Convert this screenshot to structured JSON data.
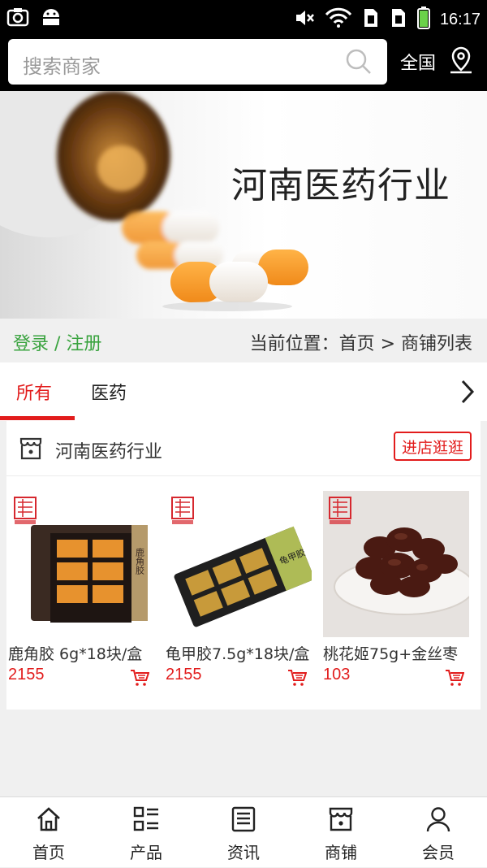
{
  "status_bar": {
    "time": "16:17"
  },
  "search": {
    "placeholder": "搜索商家",
    "region": "全国"
  },
  "banner": {
    "title": "河南医药行业"
  },
  "breadcrumb": {
    "login": "登录 / 注册",
    "location": "当前位置：首页 > 商铺列表"
  },
  "tabs": [
    {
      "label": "所有",
      "active": true
    },
    {
      "label": "医药",
      "active": false
    }
  ],
  "shop": {
    "name": "河南医药行业",
    "enter_label": "进店逛逛",
    "products": [
      {
        "name": "鹿角胶 6g*18块/盒",
        "price": "2155",
        "image_label": "鹿角胶"
      },
      {
        "name": "龟甲胶7.5g*18块/盒",
        "price": "2155",
        "image_label": "龟甲胶"
      },
      {
        "name": "桃花姬75g+金丝枣",
        "price": "103",
        "image_label": ""
      }
    ]
  },
  "bottom_nav": [
    {
      "label": "首页",
      "icon": "home-icon"
    },
    {
      "label": "产品",
      "icon": "list-icon"
    },
    {
      "label": "资讯",
      "icon": "news-icon"
    },
    {
      "label": "商铺",
      "icon": "store-icon"
    },
    {
      "label": "会员",
      "icon": "user-icon"
    }
  ],
  "colors": {
    "accent": "#e21c1c",
    "login_green": "#3aa33f",
    "header_bg": "#000000"
  }
}
